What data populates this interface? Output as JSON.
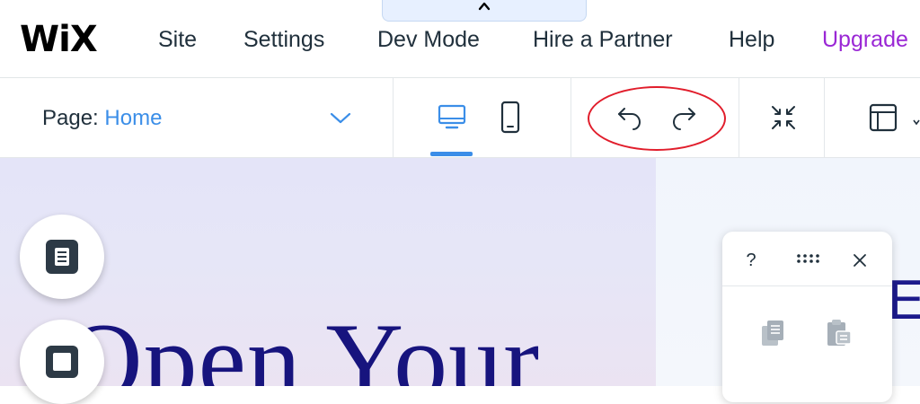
{
  "topbar": {
    "logo": "WiX",
    "menu": [
      {
        "label": "Site"
      },
      {
        "label": "Settings"
      },
      {
        "label": "Dev Mode"
      },
      {
        "label": "Hire a Partner"
      },
      {
        "label": "Help"
      },
      {
        "label": "Upgrade"
      }
    ],
    "upgrade_color": "#9a27d5"
  },
  "toolbar": {
    "page_label": "Page:",
    "page_value": "Home",
    "accent_color": "#3b8ee8",
    "buttons": [
      {
        "name": "desktop-view",
        "icon": "desktop-icon",
        "active": true
      },
      {
        "name": "mobile-view",
        "icon": "mobile-icon",
        "active": false
      },
      {
        "name": "undo",
        "icon": "undo-arrow-icon"
      },
      {
        "name": "redo",
        "icon": "redo-arrow-icon"
      },
      {
        "name": "zoom-out",
        "icon": "zoom-out-arrows-icon"
      },
      {
        "name": "layout",
        "icon": "layout-panel-icon"
      }
    ]
  },
  "annotation": {
    "shape": "ellipse",
    "color": "#e11d2b",
    "highlights": "undo-redo"
  },
  "canvas": {
    "hero_text": "Open Your",
    "hero_color": "#17147e",
    "right_letter": "E"
  },
  "side_buttons": [
    {
      "icon": "page-document-icon"
    },
    {
      "icon": "square-icon"
    }
  ],
  "floating_panel": {
    "help_label": "?",
    "icons": [
      "drag-handle-icon",
      "close-icon",
      "copy-icon",
      "paste-icon"
    ]
  }
}
